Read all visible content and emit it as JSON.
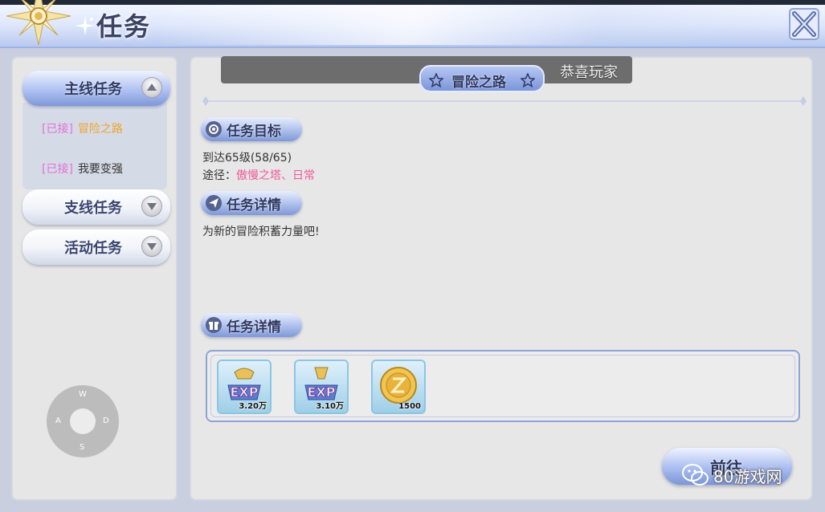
{
  "window": {
    "title": "任务",
    "close_icon": "close-x-icon"
  },
  "sidebar": {
    "categories": [
      {
        "label": "主线任务",
        "expanded": true,
        "icon": "chevron-up-icon"
      },
      {
        "label": "支线任务",
        "expanded": false,
        "icon": "chevron-down-icon"
      },
      {
        "label": "活动任务",
        "expanded": false,
        "icon": "chevron-down-icon"
      }
    ],
    "main_quests": [
      {
        "tag": "[已接]",
        "name": "冒险之路",
        "selected": true
      },
      {
        "tag": "[已接]",
        "name": "我要变强",
        "selected": false
      }
    ],
    "joystick": {
      "up": "W",
      "left": "A",
      "right": "D",
      "down": "S"
    }
  },
  "detail": {
    "notice_text": "恭喜玩家",
    "quest_title": "冒险之路",
    "objective_header": "任务目标",
    "objective_text": "到达65级(58/65)",
    "route_label": "途径：",
    "route_value": "傲慢之塔、日常",
    "details_header": "任务详情",
    "details_text": "为新的冒险积蓄力量吧!",
    "rewards_header": "任务详情",
    "rewards": [
      {
        "type": "exp",
        "label": "EXP",
        "quantity": "3.20万"
      },
      {
        "type": "exp",
        "label": "EXP",
        "quantity": "3.10万"
      },
      {
        "type": "coin",
        "quantity": "1500"
      }
    ],
    "go_button": "前往"
  },
  "watermark": {
    "text": "80游戏网",
    "icon": "wechat-icon"
  },
  "colors": {
    "accent_blue": "#7e97d8",
    "tag_pink": "#e36fd6",
    "selected_orange": "#f0a22c",
    "route_pink": "#f05a9a"
  }
}
